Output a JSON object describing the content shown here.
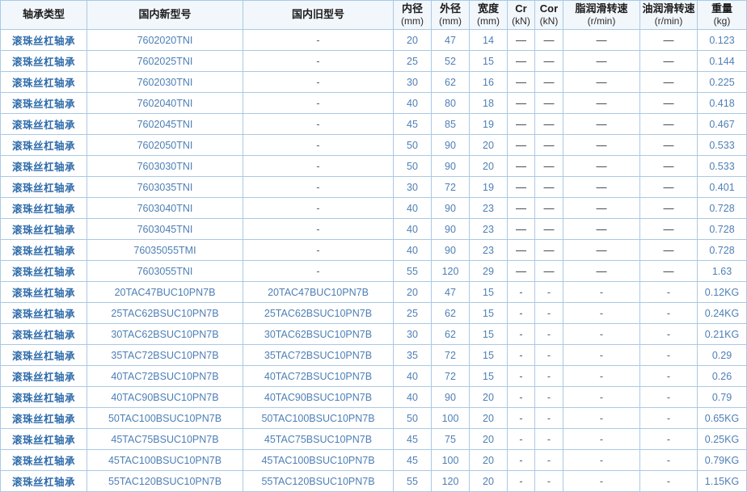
{
  "table": {
    "columns": [
      {
        "key": "type",
        "main": "轴承类型",
        "unit": ""
      },
      {
        "key": "new",
        "main": "国内新型号",
        "unit": ""
      },
      {
        "key": "old",
        "main": "国内旧型号",
        "unit": ""
      },
      {
        "key": "bore",
        "main": "内径",
        "unit": "(mm)"
      },
      {
        "key": "od",
        "main": "外径",
        "unit": "(mm)"
      },
      {
        "key": "width",
        "main": "宽度",
        "unit": "(mm)"
      },
      {
        "key": "cr",
        "main": "Cr",
        "unit": "(kN)"
      },
      {
        "key": "cor",
        "main": "Cor",
        "unit": "(kN)"
      },
      {
        "key": "grease",
        "main": "脂润滑转速",
        "unit": "(r/min)"
      },
      {
        "key": "oil",
        "main": "油润滑转速",
        "unit": "(r/min)"
      },
      {
        "key": "weight",
        "main": "重量",
        "unit": "(kg)"
      }
    ],
    "rows": [
      {
        "type": "滚珠丝杠轴承",
        "new": "7602020TNI",
        "old": "-",
        "bore": "20",
        "od": "47",
        "width": "14",
        "cr": "—",
        "cor": "—",
        "grease": "—",
        "oil": "—",
        "weight": "0.123"
      },
      {
        "type": "滚珠丝杠轴承",
        "new": "7602025TNI",
        "old": "-",
        "bore": "25",
        "od": "52",
        "width": "15",
        "cr": "—",
        "cor": "—",
        "grease": "—",
        "oil": "—",
        "weight": "0.144"
      },
      {
        "type": "滚珠丝杠轴承",
        "new": "7602030TNI",
        "old": "-",
        "bore": "30",
        "od": "62",
        "width": "16",
        "cr": "—",
        "cor": "—",
        "grease": "—",
        "oil": "—",
        "weight": "0.225"
      },
      {
        "type": "滚珠丝杠轴承",
        "new": "7602040TNI",
        "old": "-",
        "bore": "40",
        "od": "80",
        "width": "18",
        "cr": "—",
        "cor": "—",
        "grease": "—",
        "oil": "—",
        "weight": "0.418"
      },
      {
        "type": "滚珠丝杠轴承",
        "new": "7602045TNI",
        "old": "-",
        "bore": "45",
        "od": "85",
        "width": "19",
        "cr": "—",
        "cor": "—",
        "grease": "—",
        "oil": "—",
        "weight": "0.467"
      },
      {
        "type": "滚珠丝杠轴承",
        "new": "7602050TNI",
        "old": "-",
        "bore": "50",
        "od": "90",
        "width": "20",
        "cr": "—",
        "cor": "—",
        "grease": "—",
        "oil": "—",
        "weight": "0.533"
      },
      {
        "type": "滚珠丝杠轴承",
        "new": "7603030TNI",
        "old": "-",
        "bore": "50",
        "od": "90",
        "width": "20",
        "cr": "—",
        "cor": "—",
        "grease": "—",
        "oil": "—",
        "weight": "0.533"
      },
      {
        "type": "滚珠丝杠轴承",
        "new": "7603035TNI",
        "old": "-",
        "bore": "30",
        "od": "72",
        "width": "19",
        "cr": "—",
        "cor": "—",
        "grease": "—",
        "oil": "—",
        "weight": "0.401"
      },
      {
        "type": "滚珠丝杠轴承",
        "new": "7603040TNI",
        "old": "-",
        "bore": "40",
        "od": "90",
        "width": "23",
        "cr": "—",
        "cor": "—",
        "grease": "—",
        "oil": "—",
        "weight": "0.728"
      },
      {
        "type": "滚珠丝杠轴承",
        "new": "7603045TNI",
        "old": "-",
        "bore": "40",
        "od": "90",
        "width": "23",
        "cr": "—",
        "cor": "—",
        "grease": "—",
        "oil": "—",
        "weight": "0.728"
      },
      {
        "type": "滚珠丝杠轴承",
        "new": "76035055TMI",
        "old": "-",
        "bore": "40",
        "od": "90",
        "width": "23",
        "cr": "—",
        "cor": "—",
        "grease": "—",
        "oil": "—",
        "weight": "0.728"
      },
      {
        "type": "滚珠丝杠轴承",
        "new": "7603055TNI",
        "old": "-",
        "bore": "55",
        "od": "120",
        "width": "29",
        "cr": "—",
        "cor": "—",
        "grease": "—",
        "oil": "—",
        "weight": "1.63"
      },
      {
        "type": "滚珠丝杠轴承",
        "new": "20TAC47BUC10PN7B",
        "old": "20TAC47BUC10PN7B",
        "bore": "20",
        "od": "47",
        "width": "15",
        "cr": "-",
        "cor": "-",
        "grease": "-",
        "oil": "-",
        "weight": "0.12KG"
      },
      {
        "type": "滚珠丝杠轴承",
        "new": "25TAC62BSUC10PN7B",
        "old": "25TAC62BSUC10PN7B",
        "bore": "25",
        "od": "62",
        "width": "15",
        "cr": "-",
        "cor": "-",
        "grease": "-",
        "oil": "-",
        "weight": "0.24KG"
      },
      {
        "type": "滚珠丝杠轴承",
        "new": "30TAC62BSUC10PN7B",
        "old": "30TAC62BSUC10PN7B",
        "bore": "30",
        "od": "62",
        "width": "15",
        "cr": "-",
        "cor": "-",
        "grease": "-",
        "oil": "-",
        "weight": "0.21KG"
      },
      {
        "type": "滚珠丝杠轴承",
        "new": "35TAC72BSUC10PN7B",
        "old": "35TAC72BSUC10PN7B",
        "bore": "35",
        "od": "72",
        "width": "15",
        "cr": "-",
        "cor": "-",
        "grease": "-",
        "oil": "-",
        "weight": "0.29"
      },
      {
        "type": "滚珠丝杠轴承",
        "new": "40TAC72BSUC10PN7B",
        "old": "40TAC72BSUC10PN7B",
        "bore": "40",
        "od": "72",
        "width": "15",
        "cr": "-",
        "cor": "-",
        "grease": "-",
        "oil": "-",
        "weight": "0.26"
      },
      {
        "type": "滚珠丝杠轴承",
        "new": "40TAC90BSUC10PN7B",
        "old": "40TAC90BSUC10PN7B",
        "bore": "40",
        "od": "90",
        "width": "20",
        "cr": "-",
        "cor": "-",
        "grease": "-",
        "oil": "-",
        "weight": "0.79"
      },
      {
        "type": "滚珠丝杠轴承",
        "new": "50TAC100BSUC10PN7B",
        "old": "50TAC100BSUC10PN7B",
        "bore": "50",
        "od": "100",
        "width": "20",
        "cr": "-",
        "cor": "-",
        "grease": "-",
        "oil": "-",
        "weight": "0.65KG"
      },
      {
        "type": "滚珠丝杠轴承",
        "new": "45TAC75BSUC10PN7B",
        "old": "45TAC75BSUC10PN7B",
        "bore": "45",
        "od": "75",
        "width": "20",
        "cr": "-",
        "cor": "-",
        "grease": "-",
        "oil": "-",
        "weight": "0.25KG"
      },
      {
        "type": "滚珠丝杠轴承",
        "new": "45TAC100BSUC10PN7B",
        "old": "45TAC100BSUC10PN7B",
        "bore": "45",
        "od": "100",
        "width": "20",
        "cr": "-",
        "cor": "-",
        "grease": "-",
        "oil": "-",
        "weight": "0.79KG"
      },
      {
        "type": "滚珠丝杠轴承",
        "new": "55TAC120BSUC10PN7B",
        "old": "55TAC120BSUC10PN7B",
        "bore": "55",
        "od": "120",
        "width": "20",
        "cr": "-",
        "cor": "-",
        "grease": "-",
        "oil": "-",
        "weight": "1.15KG"
      }
    ]
  },
  "colors": {
    "border": "#a9c9e6",
    "header_bg": "#f2f7fb",
    "header_text": "#1b1b1b",
    "type_text": "#2f6caa",
    "cell_text": "#4e7fb5",
    "dash_text": "#3f3f3f"
  }
}
